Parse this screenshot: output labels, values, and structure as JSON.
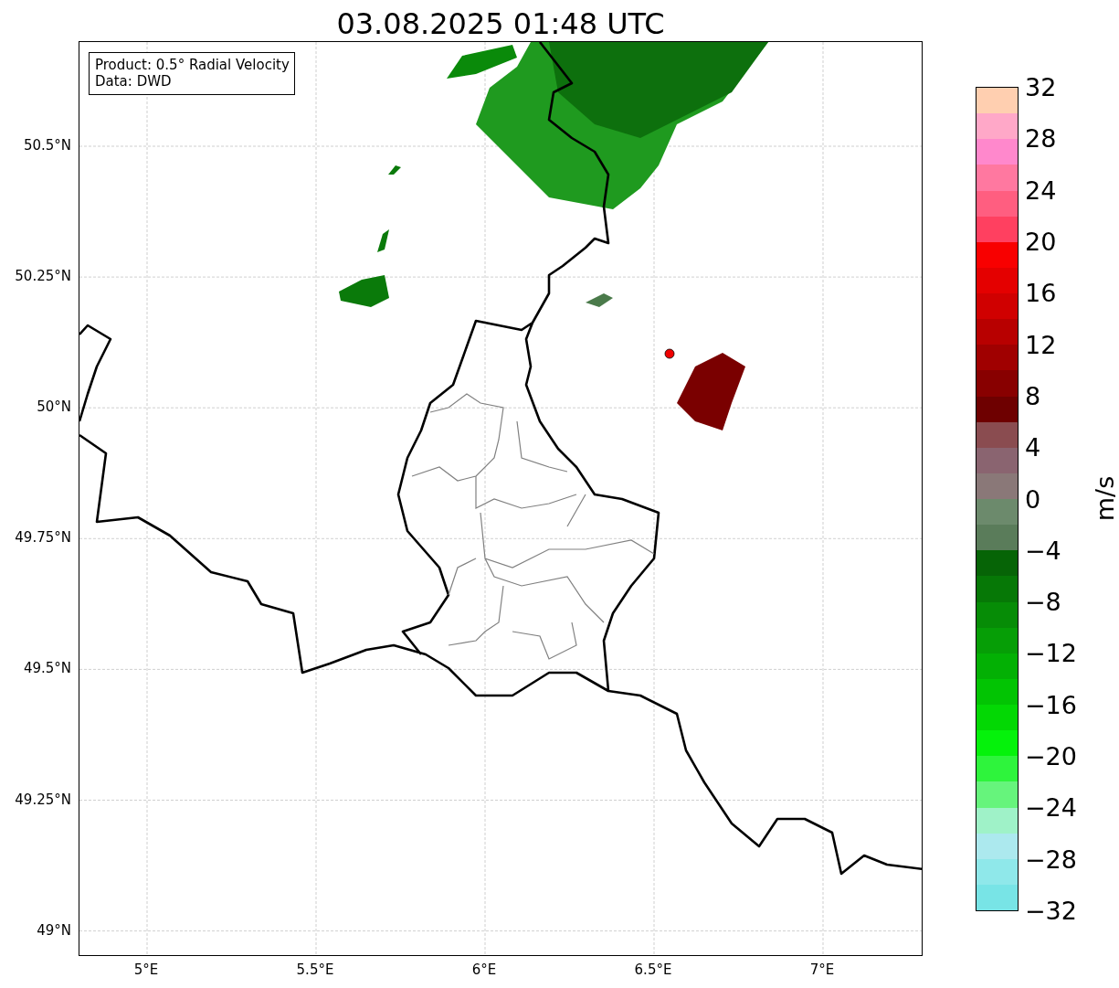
{
  "title": "03.08.2025 01:48 UTC",
  "map": {
    "info_box": [
      "Product: 0.5° Radial Velocity",
      "Data: DWD"
    ],
    "lat_labels": [
      "50.5°N",
      "50.25°N",
      "50°N",
      "49.75°N",
      "49.5°N",
      "49.25°N",
      "49°N"
    ],
    "lon_labels": [
      "5°E",
      "5.5°E",
      "6°E",
      "6.5°E",
      "7°E"
    ]
  },
  "colorbar": {
    "label": "m/s",
    "tick_labels": [
      "32",
      "28",
      "24",
      "20",
      "16",
      "12",
      "8",
      "4",
      "0",
      "−4",
      "−8",
      "−12",
      "−16",
      "−20",
      "−24",
      "−28",
      "−32"
    ],
    "bands": [
      {
        "color": "#ffcfb0"
      },
      {
        "color": "#ffa8c8"
      },
      {
        "color": "#ff88cc"
      },
      {
        "color": "#ff78a0"
      },
      {
        "color": "#ff5e80"
      },
      {
        "color": "#ff4060"
      },
      {
        "color": "#f80000"
      },
      {
        "color": "#e40000"
      },
      {
        "color": "#d00000"
      },
      {
        "color": "#b80000"
      },
      {
        "color": "#a00000"
      },
      {
        "color": "#880000"
      },
      {
        "color": "#6e0000"
      },
      {
        "color": "#8a4c50"
      },
      {
        "color": "#8a6470"
      },
      {
        "color": "#8a7878"
      },
      {
        "color": "#6c8a6c"
      },
      {
        "color": "#5a7c5a"
      },
      {
        "color": "#066406"
      },
      {
        "color": "#067806"
      },
      {
        "color": "#068c06"
      },
      {
        "color": "#069e06"
      },
      {
        "color": "#03b004"
      },
      {
        "color": "#02c403"
      },
      {
        "color": "#03d804"
      },
      {
        "color": "#05f20b"
      },
      {
        "color": "#2ef43c"
      },
      {
        "color": "#66f47c"
      },
      {
        "color": "#9ff2c8"
      },
      {
        "color": "#ace9ee"
      },
      {
        "color": "#8fe8ea"
      },
      {
        "color": "#78e4e6"
      }
    ]
  }
}
